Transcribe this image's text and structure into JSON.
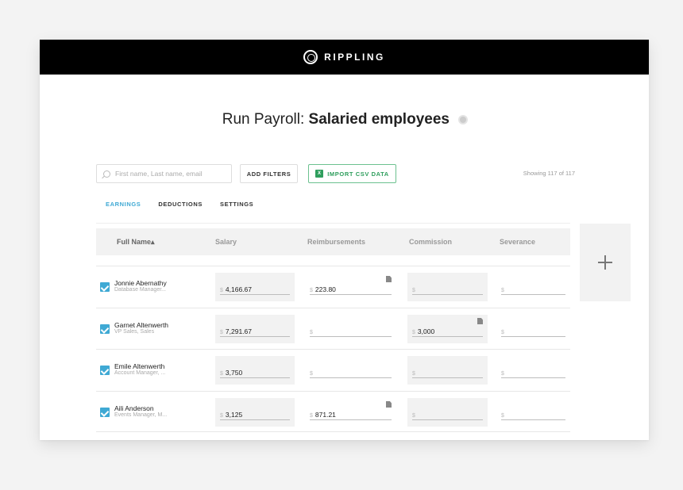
{
  "app": {
    "brand": "RIPPLING"
  },
  "page": {
    "title_prefix": "Run Payroll:",
    "title_strong": "Salaried employees"
  },
  "search": {
    "placeholder": "First name, Last name, email"
  },
  "toolbar": {
    "filters_label": "ADD FILTERS",
    "import_label": "IMPORT CSV DATA",
    "showing": "Showing 117 of 117"
  },
  "tabs": [
    {
      "label": "EARNINGS",
      "active": true
    },
    {
      "label": "DEDUCTIONS",
      "active": false
    },
    {
      "label": "SETTINGS",
      "active": false
    }
  ],
  "columns": [
    "Full Name▴",
    "Salary",
    "Reimbursements",
    "Commission",
    "Severance"
  ],
  "currency_symbol": "$",
  "rows": [
    {
      "name": "Jonnie Abernathy",
      "role": "Database Manager...",
      "salary": "4,166.67",
      "reimbursements": "223.80",
      "commission": "",
      "severance": ""
    },
    {
      "name": "Garnet Altenwerth",
      "role": "VP Sales, Sales",
      "salary": "7,291.67",
      "reimbursements": "",
      "commission": "3,000",
      "severance": ""
    },
    {
      "name": "Emile Altenwerth",
      "role": "Account Manager, ...",
      "salary": "3,750",
      "reimbursements": "",
      "commission": "",
      "severance": ""
    },
    {
      "name": "Aili Anderson",
      "role": "Events Manager, M...",
      "salary": "3,125",
      "reimbursements": "871.21",
      "commission": "",
      "severance": ""
    }
  ]
}
